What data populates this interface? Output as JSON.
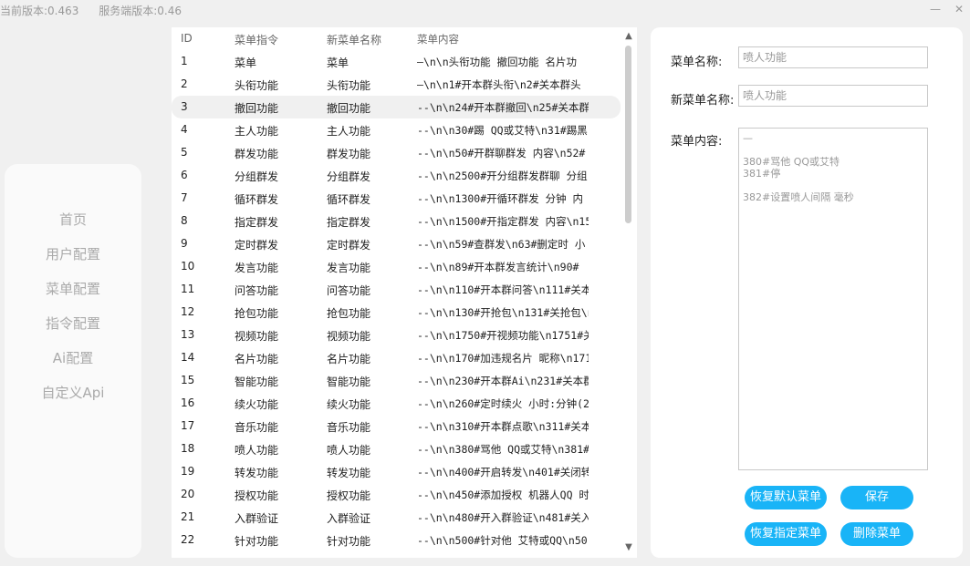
{
  "header": {
    "client_version": "当前版本:0.463",
    "server_version": "服务端版本:0.46",
    "minimize": "—",
    "close": "✕"
  },
  "sidebar": {
    "items": [
      {
        "label": "首页"
      },
      {
        "label": "用户配置"
      },
      {
        "label": "菜单配置"
      },
      {
        "label": "指令配置"
      },
      {
        "label": "Ai配置"
      },
      {
        "label": "自定义Api"
      }
    ]
  },
  "table": {
    "headers": {
      "id": "ID",
      "cmd": "菜单指令",
      "name": "新菜单名称",
      "content": "菜单内容"
    },
    "selected_index": 2,
    "rows": [
      {
        "id": "1",
        "cmd": "菜单",
        "name": "菜单",
        "content": "—\\n\\n头衔功能 撤回功能 名片功"
      },
      {
        "id": "2",
        "cmd": "头衔功能",
        "name": "头衔功能",
        "content": "—\\n\\n1#开本群头衔\\n2#关本群头"
      },
      {
        "id": "3",
        "cmd": "撤回功能",
        "name": "撤回功能",
        "content": "--\\n\\n24#开本群撤回\\n25#关本群"
      },
      {
        "id": "4",
        "cmd": "主人功能",
        "name": "主人功能",
        "content": "--\\n\\n30#踢 QQ或艾特\\n31#踢黑"
      },
      {
        "id": "5",
        "cmd": "群发功能",
        "name": "群发功能",
        "content": "--\\n\\n50#开群聊群发 内容\\n52#"
      },
      {
        "id": "6",
        "cmd": "分组群发",
        "name": "分组群发",
        "content": "--\\n\\n2500#开分组群发群聊 分组"
      },
      {
        "id": "7",
        "cmd": "循环群发",
        "name": "循环群发",
        "content": "--\\n\\n1300#开循环群发 分钟 内"
      },
      {
        "id": "8",
        "cmd": "指定群发",
        "name": "指定群发",
        "content": "--\\n\\n1500#开指定群发 内容\\n15"
      },
      {
        "id": "9",
        "cmd": "定时群发",
        "name": "定时群发",
        "content": "--\\n\\n59#查群发\\n63#删定时 小"
      },
      {
        "id": "10",
        "cmd": "发言功能",
        "name": "发言功能",
        "content": "--\\n\\n89#开本群发言统计\\n90#"
      },
      {
        "id": "11",
        "cmd": "问答功能",
        "name": "问答功能",
        "content": "--\\n\\n110#开本群问答\\n111#关本"
      },
      {
        "id": "12",
        "cmd": "抢包功能",
        "name": "抢包功能",
        "content": "--\\n\\n130#开抢包\\n131#关抢包\\n"
      },
      {
        "id": "13",
        "cmd": "视频功能",
        "name": "视频功能",
        "content": "--\\n\\n1750#开视频功能\\n1751#关"
      },
      {
        "id": "14",
        "cmd": "名片功能",
        "name": "名片功能",
        "content": "--\\n\\n170#加违规名片 昵称\\n171"
      },
      {
        "id": "15",
        "cmd": "智能功能",
        "name": "智能功能",
        "content": "--\\n\\n230#开本群Ai\\n231#关本群"
      },
      {
        "id": "16",
        "cmd": "续火功能",
        "name": "续火功能",
        "content": "--\\n\\n260#定时续火 小时:分钟(2"
      },
      {
        "id": "17",
        "cmd": "音乐功能",
        "name": "音乐功能",
        "content": "--\\n\\n310#开本群点歌\\n311#关本"
      },
      {
        "id": "18",
        "cmd": "喷人功能",
        "name": "喷人功能",
        "content": "--\\n\\n380#骂他 QQ或艾特\\n381#"
      },
      {
        "id": "19",
        "cmd": "转发功能",
        "name": "转发功能",
        "content": "--\\n\\n400#开启转发\\n401#关闭转"
      },
      {
        "id": "20",
        "cmd": "授权功能",
        "name": "授权功能",
        "content": "--\\n\\n450#添加授权 机器人QQ 时"
      },
      {
        "id": "21",
        "cmd": "入群验证",
        "name": "入群验证",
        "content": "--\\n\\n480#开入群验证\\n481#关入"
      },
      {
        "id": "22",
        "cmd": "针对功能",
        "name": "针对功能",
        "content": "--\\n\\n500#针对他 艾特或QQ\\n501"
      }
    ]
  },
  "form": {
    "menu_name_label": "菜单名称:",
    "menu_name_value": "喷人功能",
    "new_name_label": "新菜单名称:",
    "new_name_value": "喷人功能",
    "content_label": "菜单内容:",
    "content_value": "—\n\n380#骂他 QQ或艾特\n381#停\n\n382#设置喷人间隔 毫秒",
    "buttons": {
      "restore_default": "恢复默认菜单",
      "save": "保存",
      "restore_specified": "恢复指定菜单",
      "delete": "删除菜单"
    }
  },
  "colors": {
    "accent": "#19b4f7",
    "background": "#f0f0f0",
    "panel": "#ffffff"
  }
}
